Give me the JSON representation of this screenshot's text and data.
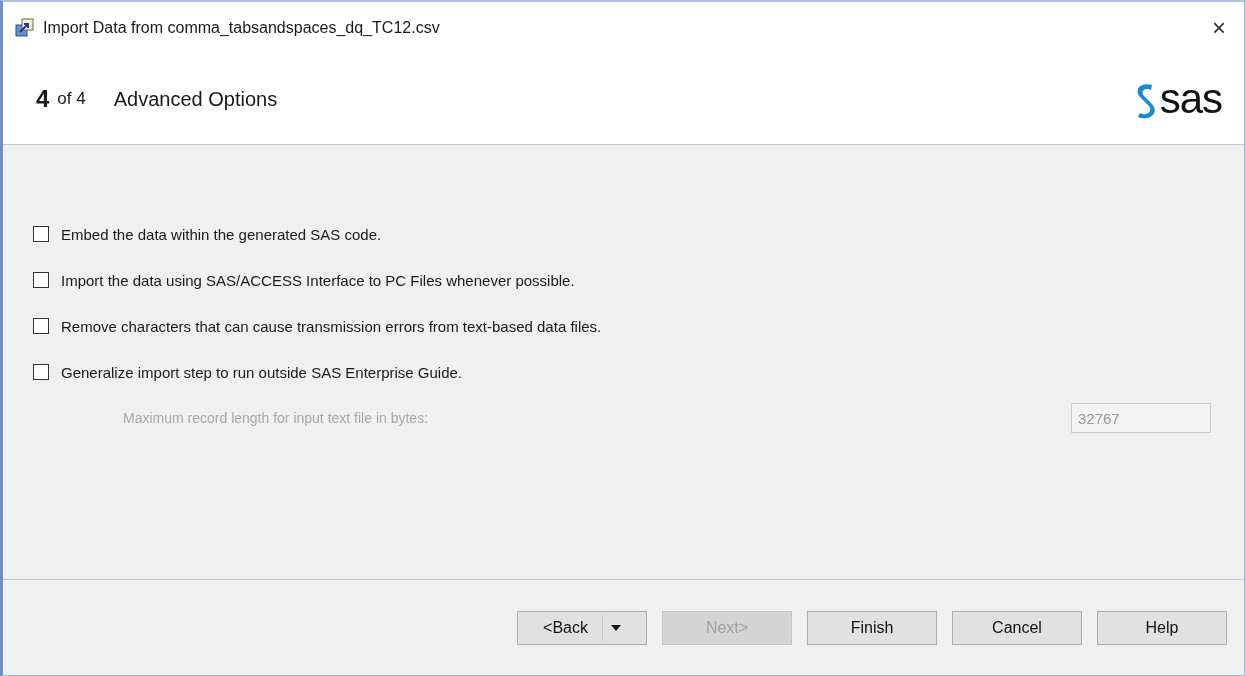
{
  "window": {
    "title": "Import Data from comma_tabsandspaces_dq_TC12.csv",
    "close": "×"
  },
  "header": {
    "step": "4",
    "of": "of 4",
    "heading": "Advanced Options",
    "logo_text": "sas"
  },
  "options": [
    {
      "label": "Embed the data within the generated SAS code.",
      "checked": false
    },
    {
      "label": "Import the data using SAS/ACCESS Interface to PC Files whenever possible.",
      "checked": false
    },
    {
      "label": "Remove characters that can cause transmission errors from text-based data files.",
      "checked": false
    },
    {
      "label": "Generalize import step to run outside SAS Enterprise Guide.",
      "checked": false
    }
  ],
  "record_length": {
    "label": "Maximum record length for input text file in bytes:",
    "value": "32767",
    "disabled": true
  },
  "buttons": [
    {
      "label": "<Back",
      "kind": "split",
      "disabled": false
    },
    {
      "label": "Next>",
      "kind": "plain",
      "disabled": true
    },
    {
      "label": "Finish",
      "kind": "plain",
      "disabled": false
    },
    {
      "label": "Cancel",
      "kind": "plain",
      "disabled": false
    },
    {
      "label": "Help",
      "kind": "plain",
      "disabled": false
    }
  ]
}
